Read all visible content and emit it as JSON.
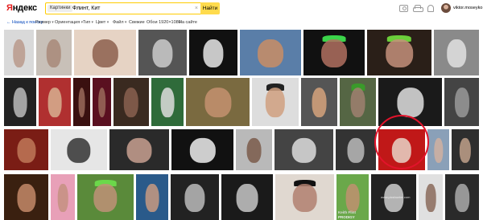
{
  "header": {
    "logo_first": "Я",
    "logo_rest": "ндекс",
    "search_chip": "Картинки",
    "search_query": "Флинт, Кит",
    "clear_symbol": "×",
    "find_button": "Найти",
    "username": "viktor.moseyko",
    "icons": [
      "camera-icon",
      "car-icon",
      "bell-icon"
    ]
  },
  "filters": {
    "back": "← Назад к поиску",
    "size": "Размер",
    "orientation": "Ориентация",
    "type": "Тип",
    "color": "Цвет",
    "file": "Файл",
    "fresh": "Свежие",
    "wallpapers": "Обои 1920×1080",
    "on_site": "На сайте"
  },
  "images": {
    "watermark": "www.picshunter.com",
    "poster_text": "Keith Flint",
    "poster_sub": "PRODIGY"
  },
  "colors": {
    "accent_yellow": "#ffdb4d",
    "logo_red": "#e51c1c",
    "highlight_red": "#e2132b",
    "link_blue": "#0044bb"
  }
}
